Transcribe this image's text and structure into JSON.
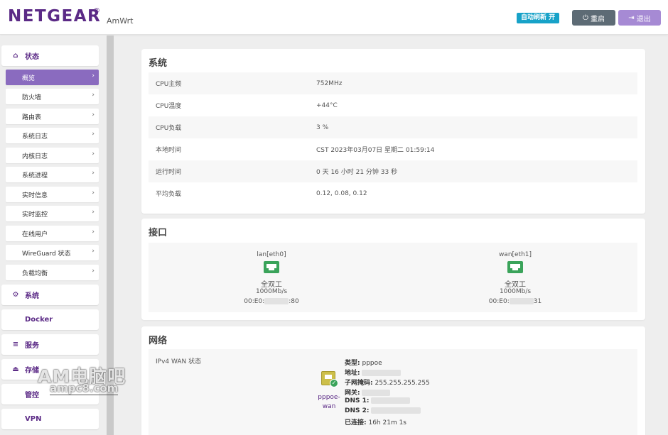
{
  "header": {
    "brand": "NETGEAR",
    "brand_mark": "®",
    "subtitle": "AmWrt",
    "autorefresh_label": "自动刷新 开",
    "reboot_label": "重启",
    "logout_label": "退出"
  },
  "sidebar": {
    "status": "状态",
    "status_items": [
      "概览",
      "防火墙",
      "路由表",
      "系统日志",
      "内核日志",
      "系统进程",
      "实时信息",
      "实时监控",
      "在线用户",
      "WireGuard 状态",
      "负载均衡"
    ],
    "system": "系统",
    "docker": "Docker",
    "services": "服务",
    "storage": "存储",
    "control": "管控",
    "vpn": "VPN"
  },
  "system_card": {
    "title": "系统",
    "rows": [
      {
        "k": "CPU主频",
        "v": "752MHz"
      },
      {
        "k": "CPU温度",
        "v": "+44°C"
      },
      {
        "k": "CPU负载",
        "v": "3 %"
      },
      {
        "k": "本地时间",
        "v": "CST 2023年03月07日 星期二 01:59:14"
      },
      {
        "k": "运行时间",
        "v": "0 天 16 小时 21 分钟 33 秒"
      },
      {
        "k": "平均负载",
        "v": "0.12, 0.08, 0.12"
      }
    ]
  },
  "iface_card": {
    "title": "接口",
    "lan": {
      "name": "lan[eth0]",
      "duplex": "全双工",
      "speed": "1000Mb/s",
      "mac_prefix": "00:E0:",
      "mac_suffix": ":80"
    },
    "wan": {
      "name": "wan[eth1]",
      "duplex": "全双工",
      "speed": "1000Mb/s",
      "mac_prefix": "00:E0:",
      "mac_suffix": "31"
    }
  },
  "net_card": {
    "title": "网络",
    "label": "IPv4 WAN 状态",
    "wan_name": "pppoe-wan",
    "type_k": "类型:",
    "type_v": "pppoe",
    "addr_k": "地址:",
    "mask_k": "子网掩码:",
    "mask_v": "255.255.255.255",
    "gw_k": "网关:",
    "dns1_k": "DNS 1:",
    "dns2_k": "DNS 2:",
    "conn_k": "已连接:",
    "conn_v": "16h 21m 1s"
  },
  "watermark": {
    "line1": "AM电脑吧",
    "line2": "ampc8.com"
  }
}
